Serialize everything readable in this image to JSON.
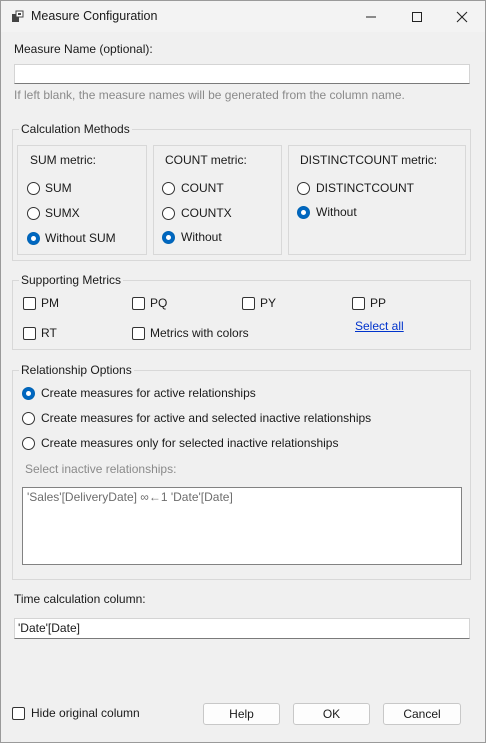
{
  "window": {
    "title": "Measure Configuration"
  },
  "measure_name": {
    "label": "Measure Name (optional):",
    "value": "",
    "hint": "If left blank, the measure names will be generated from the column name."
  },
  "calc_methods": {
    "title": "Calculation Methods",
    "sum": {
      "title": "SUM metric:",
      "options": [
        "SUM",
        "SUMX",
        "Without SUM"
      ],
      "selected": "Without SUM"
    },
    "count": {
      "title": "COUNT metric:",
      "options": [
        "COUNT",
        "COUNTX",
        "Without"
      ],
      "selected": "Without"
    },
    "distinct": {
      "title": "DISTINCTCOUNT metric:",
      "options": [
        "DISTINCTCOUNT",
        "Without"
      ],
      "selected": "Without"
    }
  },
  "supporting": {
    "title": "Supporting Metrics",
    "items": [
      {
        "label": "PM",
        "checked": false
      },
      {
        "label": "PQ",
        "checked": false
      },
      {
        "label": "PY",
        "checked": false
      },
      {
        "label": "PP",
        "checked": false
      },
      {
        "label": "RT",
        "checked": false
      },
      {
        "label": "Metrics with colors",
        "checked": false
      }
    ],
    "select_all": "Select all"
  },
  "relationships": {
    "title": "Relationship Options",
    "options": [
      "Create measures for active relationships",
      "Create measures for active and selected inactive relationships",
      "Create measures only for selected inactive relationships"
    ],
    "selected_index": 0,
    "inactive_label": "Select inactive relationships:",
    "inactive_items": [
      "'Sales'[DeliveryDate] ∞←1 'Date'[Date]"
    ]
  },
  "time_calc": {
    "label": "Time calculation column:",
    "value": "'Date'[Date]"
  },
  "footer": {
    "hide_original_label": "Hide original column",
    "hide_original_checked": false,
    "help": "Help",
    "ok": "OK",
    "cancel": "Cancel"
  },
  "colors": {
    "accent": "#0067c0",
    "link": "#0033cc",
    "disabled_text": "#8a8a8a"
  }
}
